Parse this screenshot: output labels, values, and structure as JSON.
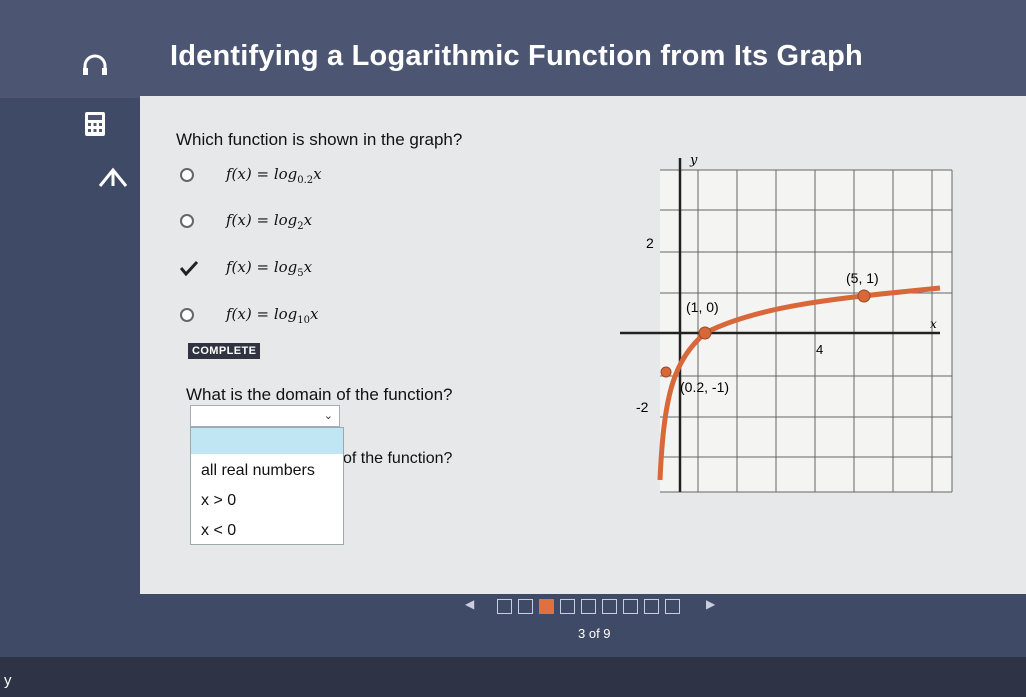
{
  "page": {
    "title": "Identifying a Logarithmic Function from Its Graph"
  },
  "sidebar": {
    "icons": [
      "headphones-icon",
      "calculator-icon",
      "arrow-up-icon"
    ]
  },
  "question1": {
    "prompt": "Which function is shown in the graph?",
    "options": [
      {
        "text": "f(x) = log",
        "base": "0.2",
        "var": "x",
        "selected": false
      },
      {
        "text": "f(x) = log",
        "base": "2",
        "var": "x",
        "selected": false
      },
      {
        "text": "f(x) = log",
        "base": "5",
        "var": "x",
        "selected": true
      },
      {
        "text": "f(x) = log",
        "base": "10",
        "var": "x",
        "selected": false
      }
    ],
    "status": "COMPLETE"
  },
  "question2": {
    "prompt": "What is the domain of the function?",
    "selected_value": "",
    "options": [
      "all real numbers",
      "x > 0",
      "x < 0"
    ]
  },
  "question3": {
    "prompt_partial": "of the function?"
  },
  "graph": {
    "axis_y_label": "y",
    "axis_x_label": "x",
    "y_tick_top": "2",
    "y_tick_bottom": "-2",
    "x_tick": "4",
    "points": [
      {
        "label": "(5, 1)"
      },
      {
        "label": "(1, 0)"
      },
      {
        "label": "(0.2, -1)"
      }
    ],
    "curve_color": "#d8683a"
  },
  "navigation": {
    "page_count": "3 of 9",
    "current_index": 2,
    "total": 9
  },
  "corner": {
    "text": "y"
  }
}
